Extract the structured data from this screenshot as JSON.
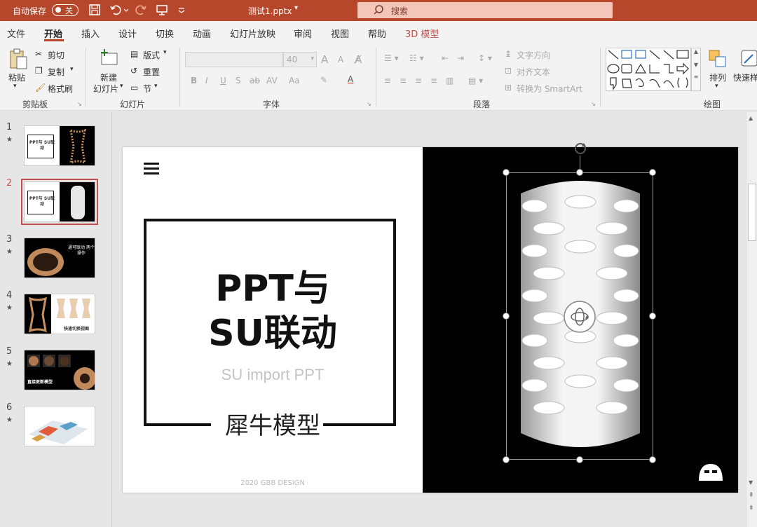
{
  "titlebar": {
    "autosave_label": "自动保存",
    "autosave_state": "关",
    "doc_title": "测试1.pptx",
    "search_placeholder": "搜索",
    "accent": "#b7472a"
  },
  "menu": {
    "items": [
      "文件",
      "开始",
      "插入",
      "设计",
      "切换",
      "动画",
      "幻灯片放映",
      "审阅",
      "视图",
      "帮助",
      "3D 模型"
    ],
    "active": "开始"
  },
  "ribbon": {
    "clipboard": {
      "paste": "粘贴",
      "cut": "剪切",
      "copy": "复制",
      "format_painter": "格式刷",
      "label": "剪贴板"
    },
    "slides": {
      "new_slide_1": "新建",
      "new_slide_2": "幻灯片",
      "layout": "版式",
      "reset": "重置",
      "section": "节",
      "label": "幻灯片"
    },
    "font": {
      "size": "40",
      "bold": "B",
      "italic": "I",
      "underline": "U",
      "shadow": "S",
      "strike": "ab",
      "spacing": "AV",
      "case": "Aa",
      "grow": "A",
      "shrink": "A",
      "label": "字体"
    },
    "paragraph": {
      "text_direction": "文字方向",
      "align_text": "对齐文本",
      "smartart": "转换为 SmartArt",
      "label": "段落"
    },
    "drawing": {
      "arrange": "排列",
      "quick_styles": "快速样",
      "label": "绘图"
    }
  },
  "thumbnails": [
    {
      "num": "1",
      "text": "PPT与 SU联动"
    },
    {
      "num": "2",
      "text": "PPT与 SU联动"
    },
    {
      "num": "3",
      "text": "通可联动 两个 操作"
    },
    {
      "num": "4",
      "text": "快速切换视图"
    },
    {
      "num": "5",
      "text": "直接更新模型"
    },
    {
      "num": "6",
      "text": ""
    }
  ],
  "selected_thumbnail": 2,
  "slide": {
    "title_line1": "PPT与",
    "title_line2": "SU联动",
    "subtitle": "SU import PPT",
    "brand": "犀牛模型",
    "footer": "2020 GBB DESIGN"
  }
}
